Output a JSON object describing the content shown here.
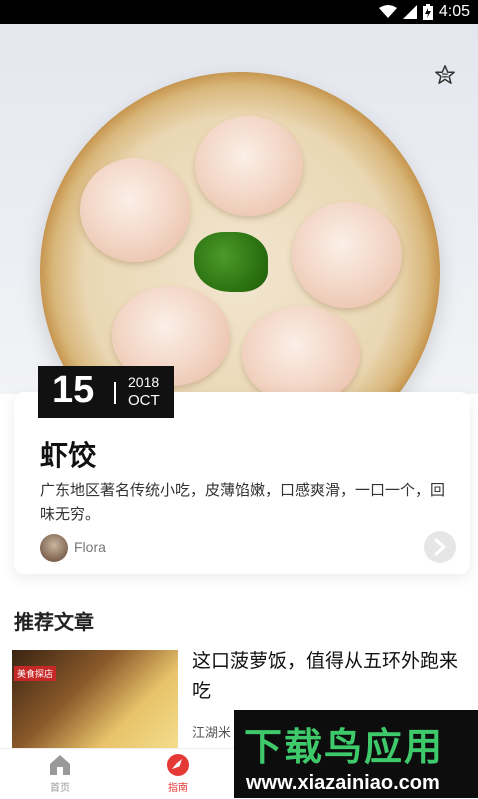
{
  "status_bar": {
    "time": "4:05"
  },
  "hero": {
    "image_alt": "dumpling-photo"
  },
  "date_badge": {
    "day": "15",
    "year": "2018",
    "month": "OCT"
  },
  "card": {
    "title": "虾饺",
    "description": "广东地区著名传统小吃，皮薄馅嫩，口感爽滑，一口一个，回味无穷。",
    "author": "Flora",
    "next_icon": "chevron-right-icon"
  },
  "section": {
    "title": "推荐文章"
  },
  "article": {
    "tag": "美食探店",
    "title": "这口菠萝饭，值得从五环外跑来吃",
    "source": "江湖米"
  },
  "tabbar": {
    "items": [
      {
        "label": "首页",
        "icon": "home-icon",
        "color": "#999999"
      },
      {
        "label": "指南",
        "icon": "compass-icon",
        "color": "#e53935"
      }
    ]
  },
  "promo": {
    "main": "下载鸟应用",
    "url": "www.xiazainiao.com"
  },
  "colors": {
    "accent": "#e53935",
    "status_bar": "#000000"
  }
}
